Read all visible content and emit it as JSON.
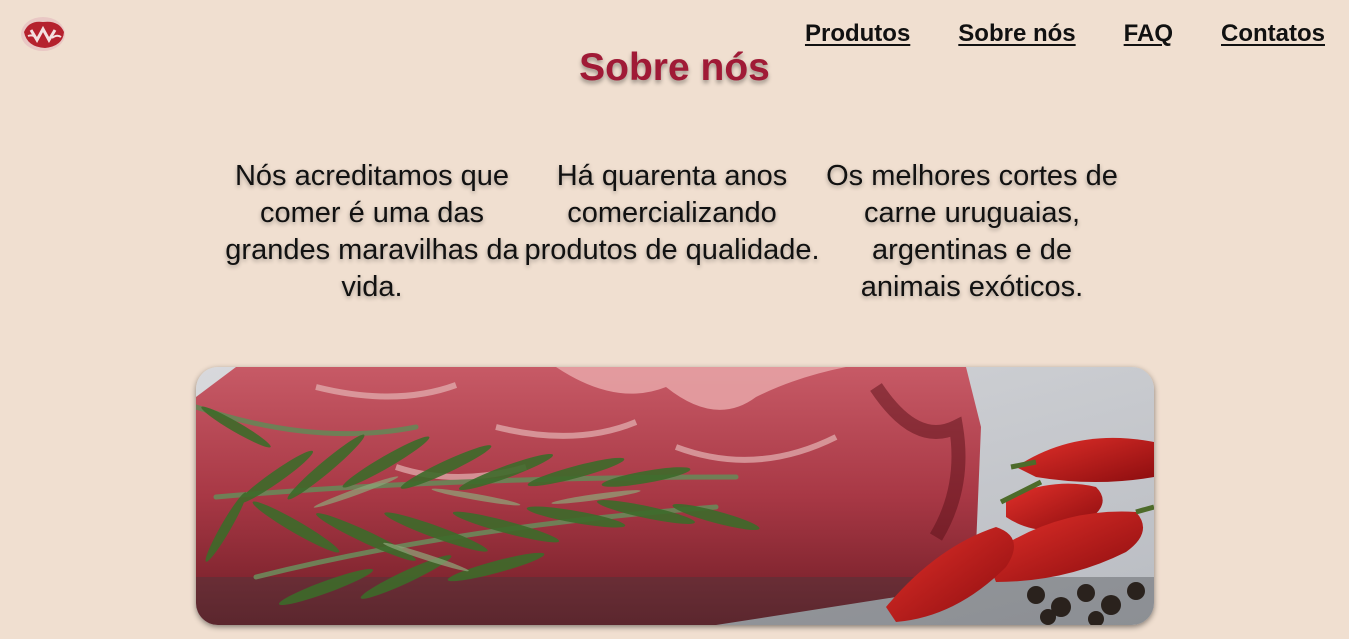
{
  "nav": {
    "items": [
      {
        "label": "Produtos"
      },
      {
        "label": "Sobre nós"
      },
      {
        "label": "FAQ"
      },
      {
        "label": "Contatos"
      }
    ]
  },
  "page": {
    "title": "Sobre nós"
  },
  "features": [
    {
      "text": "Nós acreditamos que comer é uma das grandes maravilhas da vida."
    },
    {
      "text": "Há quarenta anos comercializando produtos de qualidade."
    },
    {
      "text": "Os melhores cortes de carne uruguaias, argentinas e de animais exóticos."
    }
  ],
  "colors": {
    "background": "#f0dfd0",
    "title": "#a01a36",
    "link": "#111111"
  },
  "icons": {
    "logo": "meat-logo-icon",
    "hero": "meat-rosemary-pepper-photo"
  }
}
